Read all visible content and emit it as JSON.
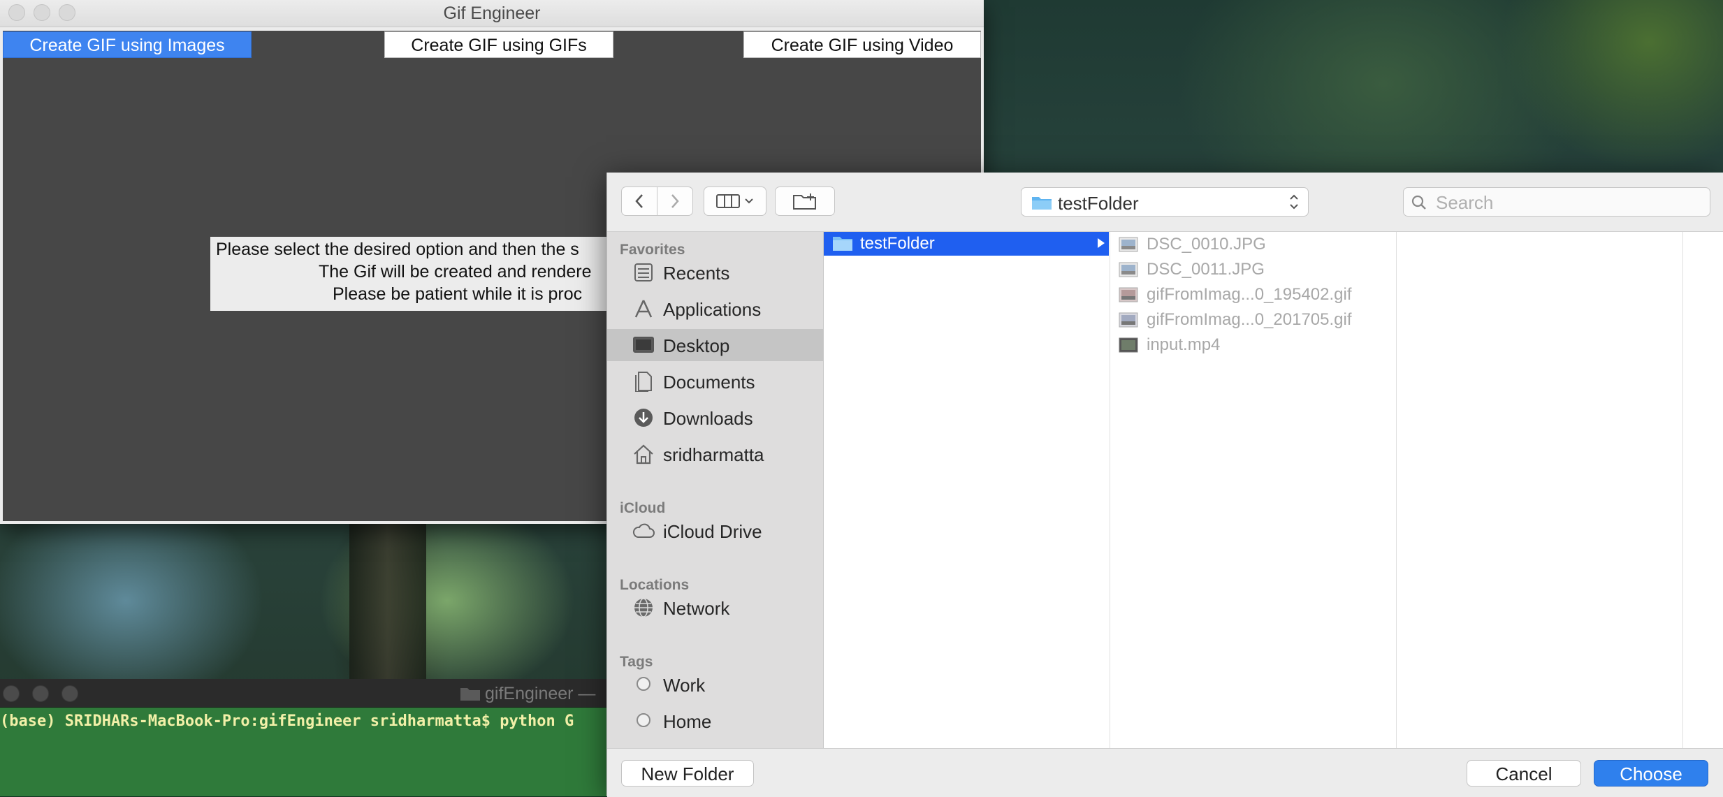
{
  "app_window": {
    "title": "Gif Engineer",
    "tabs": [
      {
        "label": "Create GIF using Images",
        "active": true
      },
      {
        "label": "Create GIF using GIFs",
        "active": false
      },
      {
        "label": "Create GIF using Video",
        "active": false
      }
    ],
    "info_lines": [
      "Please select the desired option and then the s",
      "The Gif will be created and rendere",
      "Please be patient while it is proc"
    ]
  },
  "terminal": {
    "title": "gifEngineer —",
    "prompt_line": "(base) SRIDHARs-MacBook-Pro:gifEngineer sridharmatta$ python G"
  },
  "dialog": {
    "current_folder": "testFolder",
    "search": {
      "placeholder": "Search",
      "value": ""
    },
    "sidebar": {
      "favorites_header": "Favorites",
      "favorites": [
        {
          "label": "Recents",
          "icon": "recents-icon"
        },
        {
          "label": "Applications",
          "icon": "applications-icon"
        },
        {
          "label": "Desktop",
          "icon": "desktop-icon",
          "selected": true
        },
        {
          "label": "Documents",
          "icon": "documents-icon"
        },
        {
          "label": "Downloads",
          "icon": "downloads-icon"
        },
        {
          "label": "sridharmatta",
          "icon": "home-icon"
        }
      ],
      "icloud_header": "iCloud",
      "icloud": [
        {
          "label": "iCloud Drive",
          "icon": "cloud-icon"
        }
      ],
      "locations_header": "Locations",
      "locations": [
        {
          "label": "Network",
          "icon": "network-icon"
        }
      ],
      "tags_header": "Tags",
      "tags": [
        {
          "label": "Work"
        },
        {
          "label": "Home"
        }
      ]
    },
    "column1": {
      "selected_item": "testFolder"
    },
    "files": [
      {
        "name": "DSC_0010.JPG",
        "icon": "image-icon"
      },
      {
        "name": "DSC_0011.JPG",
        "icon": "image-icon"
      },
      {
        "name": "gifFromImag...0_195402.gif",
        "icon": "gif-icon"
      },
      {
        "name": "gifFromImag...0_201705.gif",
        "icon": "gif-icon"
      },
      {
        "name": "input.mp4",
        "icon": "video-icon"
      }
    ],
    "buttons": {
      "new_folder": "New Folder",
      "cancel": "Cancel",
      "choose": "Choose"
    }
  },
  "colors": {
    "accent_blue": "#1f5ff0",
    "app_background": "#474747",
    "terminal_background": "#2f7a3a"
  }
}
